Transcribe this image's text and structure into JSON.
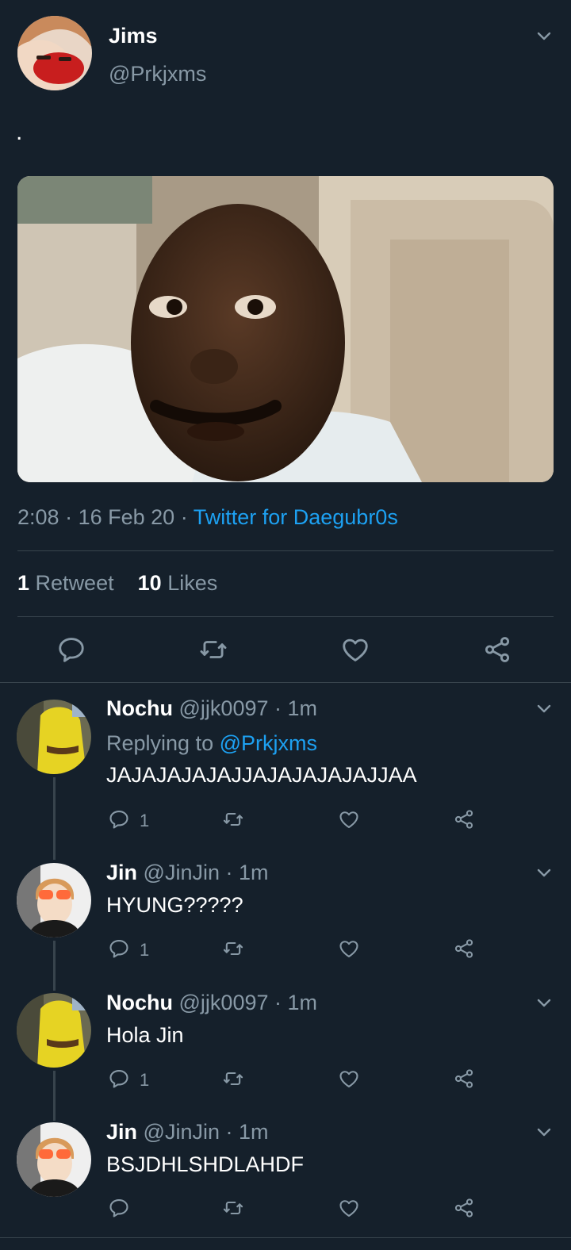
{
  "tweet": {
    "author_name": "Jims",
    "author_handle": "@Prkjxms",
    "text": ".",
    "time": "2:08",
    "date": "16 Feb 20",
    "source": "Twitter for Daegubr0s",
    "sep": "·",
    "retweet_count": "1",
    "retweet_label": "Retweet",
    "like_count": "10",
    "like_label": "Likes"
  },
  "replies": [
    {
      "name": "Nochu",
      "handle": "@jjk0097",
      "time": "· 1m",
      "replying_prefix": "Replying to",
      "replying_handle": "@Prkjxms",
      "text": "JAJAJAJAJAJJAJAJAJAJAJJAA",
      "reply_count": "1"
    },
    {
      "name": "Jin",
      "handle": "@JinJin",
      "time": "· 1m",
      "text": "HYUNG?????",
      "reply_count": "1"
    },
    {
      "name": "Nochu",
      "handle": "@jjk0097",
      "time": "· 1m",
      "text": "Hola Jin",
      "reply_count": "1"
    },
    {
      "name": "Jin",
      "handle": "@JinJin",
      "time": "· 1m",
      "text": "BSJDHLSHDLAHDF",
      "reply_count": ""
    }
  ],
  "colors": {
    "background": "#15202b",
    "accent": "#1da1f2",
    "muted": "#8899a6",
    "divider": "#38444d"
  },
  "icons": [
    "chevron-down-icon",
    "reply-icon",
    "retweet-icon",
    "like-icon",
    "share-icon"
  ]
}
